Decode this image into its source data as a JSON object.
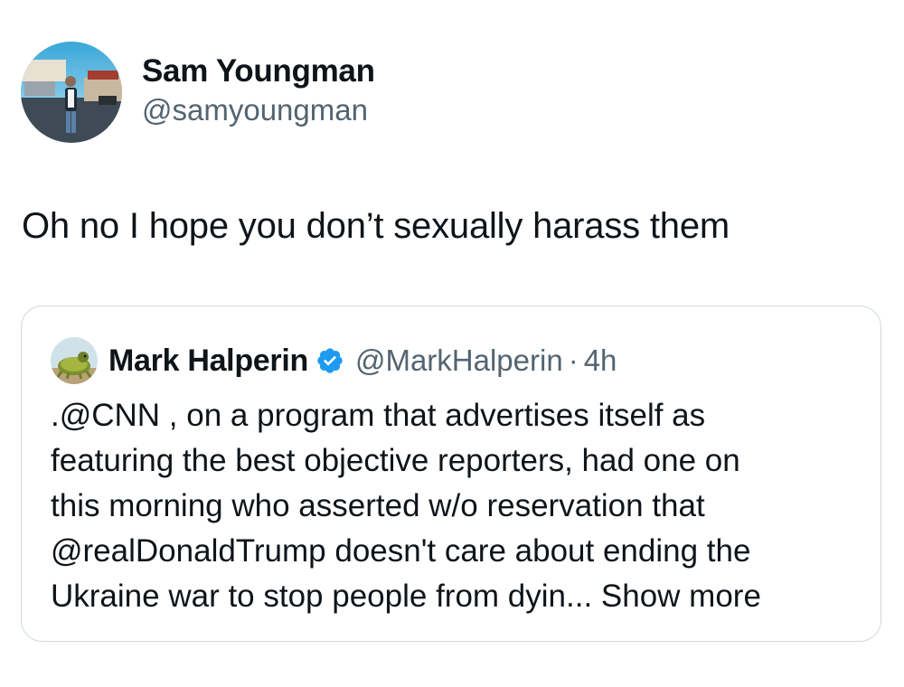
{
  "tweet": {
    "author": {
      "display_name": "Sam Youngman",
      "handle": "@samyoungman",
      "avatar": "profile-photo"
    },
    "text": "Oh no I hope you don’t sexually harass them"
  },
  "quoted_tweet": {
    "author": {
      "display_name": "Mark Halperin",
      "handle": "@MarkHalperin",
      "verified": true,
      "avatar": "profile-photo"
    },
    "separator": "·",
    "time": "4h",
    "text_lines": [
      ".@CNN , on a program that advertises itself as",
      "featuring the best objective reporters, had one on",
      "this morning who asserted w/o reservation that",
      "@realDonaldTrump doesn't care about ending the",
      "Ukraine war to stop people from dyin..."
    ],
    "show_more_label": "Show more"
  },
  "colors": {
    "text": "#0f1419",
    "secondary": "#536471",
    "border": "#cfd9de",
    "verified": "#1d9bf0"
  }
}
